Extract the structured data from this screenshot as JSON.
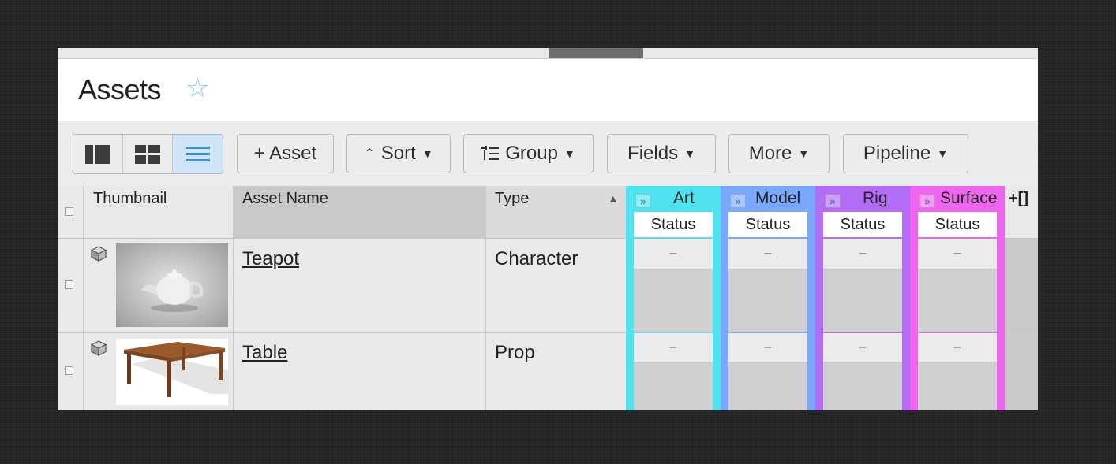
{
  "header": {
    "title": "Assets"
  },
  "toolbar": {
    "add_asset": "+ Asset",
    "sort": "Sort",
    "group": "Group",
    "fields": "Fields",
    "more": "More",
    "pipeline": "Pipeline"
  },
  "columns": {
    "thumbnail": "Thumbnail",
    "asset_name": "Asset Name",
    "type": "Type"
  },
  "pipeline_steps": [
    {
      "name": "Art",
      "sub": "Status",
      "color": "#4fe3f0"
    },
    {
      "name": "Model",
      "sub": "Status",
      "color": "#7aa8ff"
    },
    {
      "name": "Rig",
      "sub": "Status",
      "color": "#b26cf5"
    },
    {
      "name": "Surface",
      "sub": "Status",
      "color": "#f065f0"
    }
  ],
  "rows": [
    {
      "name": "Teapot",
      "type": "Character",
      "statuses": [
        "–",
        "–",
        "–",
        "–"
      ]
    },
    {
      "name": "Table",
      "type": "Prop",
      "statuses": [
        "–",
        "–",
        "–",
        "–"
      ]
    }
  ],
  "add_column_icon": "+[]"
}
